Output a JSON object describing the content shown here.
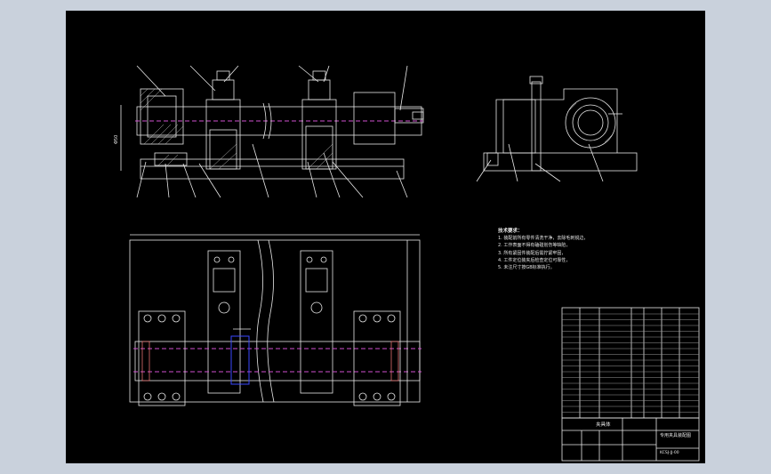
{
  "drawing": {
    "technical_requirements": {
      "title": "技术要求：",
      "items": [
        "1. 装配前所有零件清洗干净，去除毛刺锐边，",
        "2. 工作表面不得有磕碰划伤等缺陷，",
        "3. 所有紧固件装配后需拧紧牢固，",
        "4. 工件定位装夹后检查定位可靠性，",
        "5. 未注尺寸按GB标准执行。"
      ]
    },
    "title_block": {
      "part_name": "夹具体",
      "drawing_title": "专用夹具装配图",
      "drawing_number": "KCSJ-JJ-00"
    }
  }
}
